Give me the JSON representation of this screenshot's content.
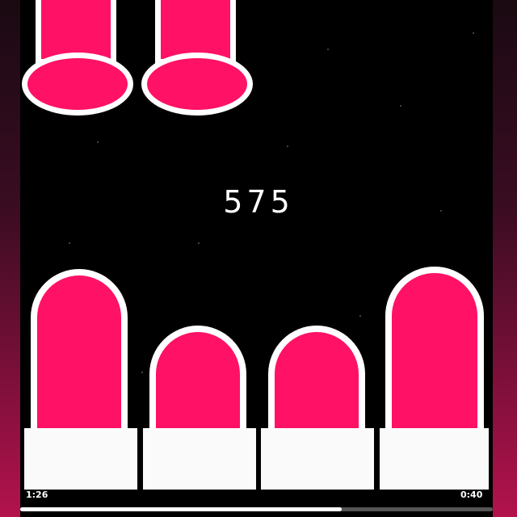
{
  "game": {
    "score": "575",
    "tile_color": "#ff1166",
    "outline_color": "#ffffff",
    "lanes": 4,
    "pillar_levels": [
      0.73,
      0.48,
      0.48,
      0.78
    ]
  },
  "player": {
    "elapsed": "1:26",
    "remaining": "0:40",
    "progress": 0.68
  }
}
